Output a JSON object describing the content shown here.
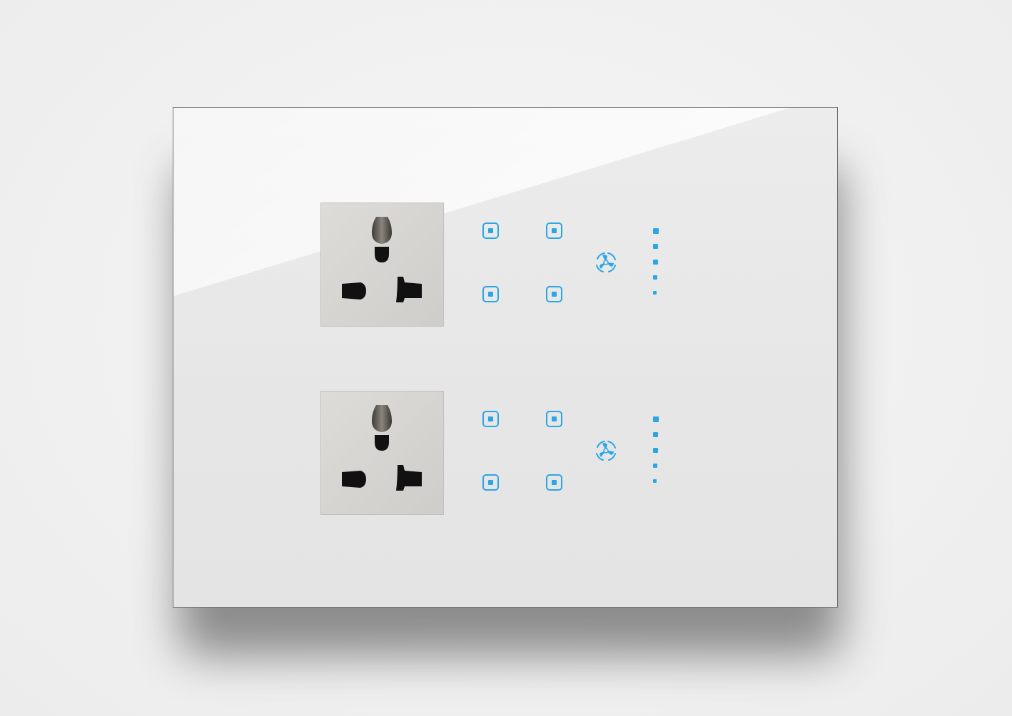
{
  "product": {
    "frame_color": "#e8e8e8",
    "indicator_color": "#2aa6e6",
    "socket_color": "#d8d7d3"
  },
  "modules": [
    {
      "socket_icon": "universal-socket",
      "switches": [
        "switch-1",
        "switch-2",
        "switch-3",
        "switch-4"
      ],
      "fan_icon": "fan-icon",
      "speed_levels": 5
    },
    {
      "socket_icon": "universal-socket",
      "switches": [
        "switch-1",
        "switch-2",
        "switch-3",
        "switch-4"
      ],
      "fan_icon": "fan-icon",
      "speed_levels": 5
    }
  ]
}
